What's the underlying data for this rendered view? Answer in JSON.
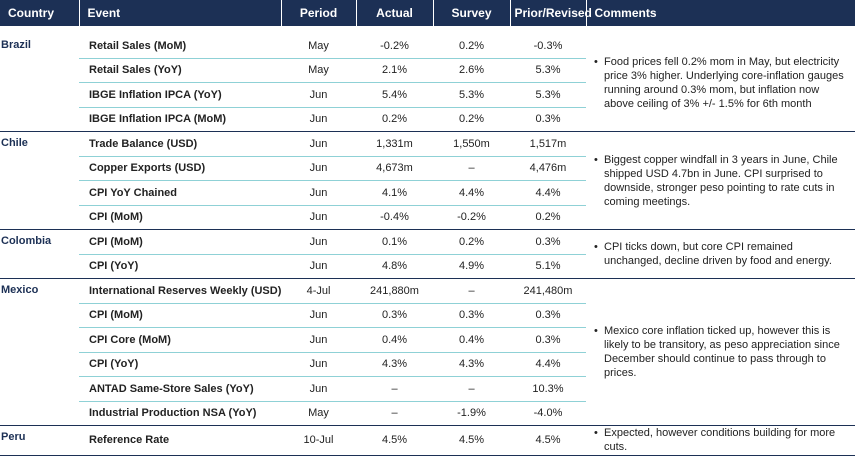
{
  "headers": [
    "Country",
    "Event",
    "Period",
    "Actual",
    "Survey",
    "Prior/Revised",
    "Comments"
  ],
  "bullet": "•",
  "groups": [
    {
      "country": "Brazil",
      "comment": "Food prices fell 0.2% mom in May, but electricity price 3% higher. Underlying core-inflation gauges running around 0.3% mom, but inflation now above ceiling of 3% +/- 1.5% for 6th month",
      "rows": [
        {
          "event": "Retail Sales (MoM)",
          "period": "May",
          "actual": "-0.2%",
          "survey": "0.2%",
          "prior": "-0.3%"
        },
        {
          "event": "Retail Sales (YoY)",
          "period": "May",
          "actual": "2.1%",
          "survey": "2.6%",
          "prior": "5.3%"
        },
        {
          "event": "IBGE Inflation IPCA (YoY)",
          "period": "Jun",
          "actual": "5.4%",
          "survey": "5.3%",
          "prior": "5.3%"
        },
        {
          "event": "IBGE Inflation IPCA (MoM)",
          "period": "Jun",
          "actual": "0.2%",
          "survey": "0.2%",
          "prior": "0.3%"
        }
      ]
    },
    {
      "country": "Chile",
      "comment": "Biggest copper windfall in 3 years in June, Chile shipped USD 4.7bn in June. CPI surprised to downside, stronger peso pointing to rate cuts in coming meetings.",
      "rows": [
        {
          "event": "Trade Balance (USD)",
          "period": "Jun",
          "actual": "1,331m",
          "survey": "1,550m",
          "prior": "1,517m"
        },
        {
          "event": "Copper Exports (USD)",
          "period": "Jun",
          "actual": "4,673m",
          "survey": "–",
          "prior": "4,476m"
        },
        {
          "event": "CPI YoY Chained",
          "period": "Jun",
          "actual": "4.1%",
          "survey": "4.4%",
          "prior": "4.4%"
        },
        {
          "event": "CPI (MoM)",
          "period": "Jun",
          "actual": "-0.4%",
          "survey": "-0.2%",
          "prior": "0.2%"
        }
      ]
    },
    {
      "country": "Colombia",
      "comment": "CPI ticks down, but core CPI remained unchanged, decline driven by food and energy.",
      "rows": [
        {
          "event": "CPI (MoM)",
          "period": "Jun",
          "actual": "0.1%",
          "survey": "0.2%",
          "prior": "0.3%"
        },
        {
          "event": "CPI (YoY)",
          "period": "Jun",
          "actual": "4.8%",
          "survey": "4.9%",
          "prior": "5.1%"
        }
      ]
    },
    {
      "country": "Mexico",
      "comment": "Mexico core inflation ticked up, however this is likely to be transitory, as peso appreciation since December should continue to pass through to prices.",
      "rows": [
        {
          "event": "International Reserves Weekly (USD)",
          "period": "4-Jul",
          "actual": "241,880m",
          "survey": "–",
          "prior": "241,480m"
        },
        {
          "event": "CPI (MoM)",
          "period": "Jun",
          "actual": "0.3%",
          "survey": "0.3%",
          "prior": "0.3%"
        },
        {
          "event": "CPI Core (MoM)",
          "period": "Jun",
          "actual": "0.4%",
          "survey": "0.4%",
          "prior": "0.3%"
        },
        {
          "event": "CPI (YoY)",
          "period": "Jun",
          "actual": "4.3%",
          "survey": "4.3%",
          "prior": "4.4%"
        },
        {
          "event": "ANTAD Same-Store Sales (YoY)",
          "period": "Jun",
          "actual": "–",
          "survey": "–",
          "prior": "10.3%"
        },
        {
          "event": "Industrial Production NSA (YoY)",
          "period": "May",
          "actual": "–",
          "survey": "-1.9%",
          "prior": "-4.0%"
        }
      ]
    },
    {
      "country": "Peru",
      "comment": "Expected, however conditions building for more cuts.",
      "rows": [
        {
          "event": "Reference Rate",
          "period": "10-Jul",
          "actual": "4.5%",
          "survey": "4.5%",
          "prior": "4.5%"
        }
      ]
    }
  ]
}
